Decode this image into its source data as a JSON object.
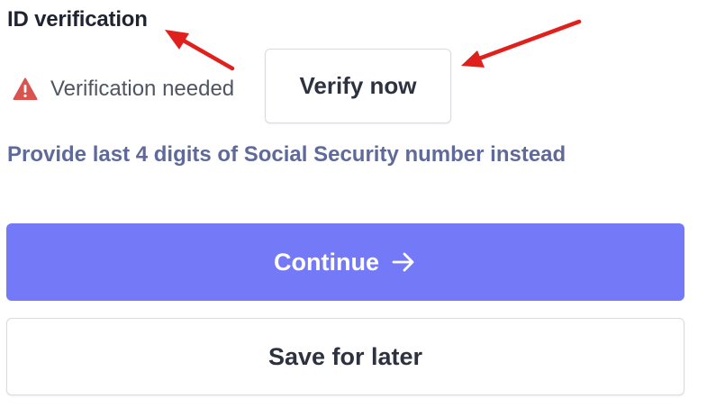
{
  "id_verification": {
    "title": "ID verification",
    "status_text": "Verification needed",
    "status_icon": "warning-triangle-icon",
    "verify_button_label": "Verify now"
  },
  "ssn_link": {
    "label": "Provide last 4 digits of Social Security number instead"
  },
  "actions": {
    "continue_label": "Continue",
    "continue_icon": "arrow-right-icon",
    "save_label": "Save for later"
  },
  "colors": {
    "primary": "#7479f7",
    "warning": "#d9534f",
    "link": "#5f6a9a",
    "annotation_arrow": "#e0201c"
  }
}
